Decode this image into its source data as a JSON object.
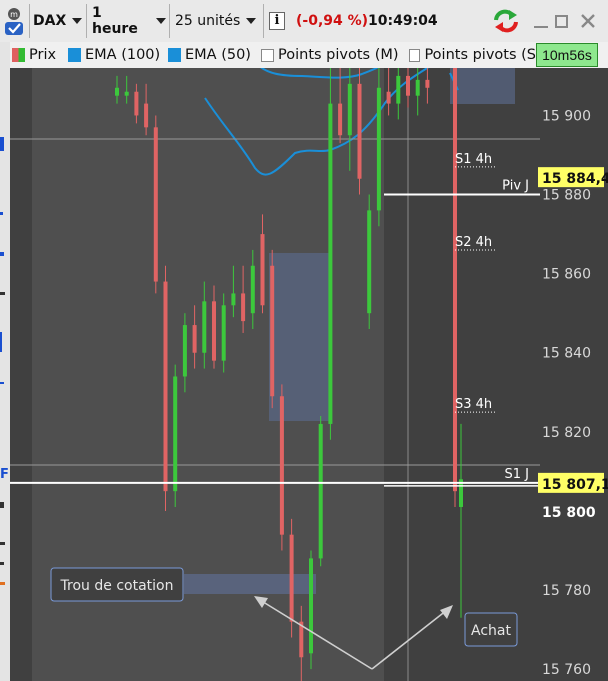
{
  "toolbar": {
    "symbol": "DAX",
    "timeframe": "1 heure",
    "units": "25 unités",
    "info_icon": "info-icon",
    "change_pct": "(-0,94 %)",
    "time": "10:49:04",
    "refresh_icon": "refresh-arrows-icon",
    "window_buttons": [
      "minimize-icon",
      "maximize-icon",
      "close-icon"
    ]
  },
  "legend": {
    "items": [
      {
        "label": "Prix",
        "color": "#e06060",
        "kind": "swatch"
      },
      {
        "label": "EMA (100)",
        "color": "#1a8fd8",
        "kind": "swatch"
      },
      {
        "label": "EMA (50)",
        "color": "#1a8fd8",
        "kind": "swatch"
      },
      {
        "label": "Points pivots (M)",
        "kind": "checkbox"
      },
      {
        "label": "Points pivots (S",
        "kind": "checkbox"
      }
    ],
    "countdown": "10m56s"
  },
  "chart_data": {
    "type": "candlestick",
    "yaxis": {
      "range": [
        15757,
        15912
      ],
      "ticks": [
        "15 760",
        "15 780",
        "15 800",
        "15 820",
        "15 840",
        "15 860",
        "15 880",
        "15 900"
      ],
      "tick_values": [
        15760,
        15780,
        15800,
        15820,
        15840,
        15860,
        15880,
        15900
      ]
    },
    "price_tags": [
      {
        "label": "15 884,4",
        "value": 15884.4,
        "background": "#ffff66"
      },
      {
        "label": "15 807,1",
        "value": 15807.1,
        "background": "#ffff66"
      },
      {
        "label": "15 800",
        "value": 15800,
        "background": "#404040"
      }
    ],
    "candles": [
      {
        "o": 15905,
        "h": 15910,
        "l": 15903,
        "c": 15907
      },
      {
        "o": 15905,
        "h": 15910,
        "l": 15903,
        "c": 15906
      },
      {
        "o": 15906,
        "h": 15908,
        "l": 15898,
        "c": 15900
      },
      {
        "o": 15903,
        "h": 15908,
        "l": 15895,
        "c": 15897
      },
      {
        "o": 15897,
        "h": 15900,
        "l": 15855,
        "c": 15858
      },
      {
        "o": 15858,
        "h": 15862,
        "l": 15800,
        "c": 15805
      },
      {
        "o": 15805,
        "h": 15837,
        "l": 15801,
        "c": 15834
      },
      {
        "o": 15834,
        "h": 15850,
        "l": 15830,
        "c": 15847
      },
      {
        "o": 15847,
        "h": 15852,
        "l": 15836,
        "c": 15840
      },
      {
        "o": 15840,
        "h": 15858,
        "l": 15836,
        "c": 15853
      },
      {
        "o": 15853,
        "h": 15857,
        "l": 15836,
        "c": 15838
      },
      {
        "o": 15838,
        "h": 15855,
        "l": 15835,
        "c": 15852
      },
      {
        "o": 15852,
        "h": 15862,
        "l": 15849,
        "c": 15855
      },
      {
        "o": 15855,
        "h": 15862,
        "l": 15845,
        "c": 15848
      },
      {
        "o": 15850,
        "h": 15866,
        "l": 15846,
        "c": 15862
      },
      {
        "o": 15870,
        "h": 15875,
        "l": 15850,
        "c": 15852
      },
      {
        "o": 15862,
        "h": 15866,
        "l": 15826,
        "c": 15829
      },
      {
        "o": 15829,
        "h": 15832,
        "l": 15790,
        "c": 15794
      },
      {
        "o": 15794,
        "h": 15798,
        "l": 15768,
        "c": 15772
      },
      {
        "o": 15772,
        "h": 15776,
        "l": 15757,
        "c": 15763
      },
      {
        "o": 15764,
        "h": 15790,
        "l": 15760,
        "c": 15788
      },
      {
        "o": 15788,
        "h": 15824,
        "l": 15786,
        "c": 15822
      },
      {
        "o": 15822,
        "h": 15912,
        "l": 15818,
        "c": 15903
      },
      {
        "o": 15903,
        "h": 15912,
        "l": 15893,
        "c": 15895
      },
      {
        "o": 15895,
        "h": 15912,
        "l": 15886,
        "c": 15908
      },
      {
        "o": 15908,
        "h": 15912,
        "l": 15880,
        "c": 15884
      },
      {
        "o": 15850,
        "h": 15880,
        "l": 15846,
        "c": 15876
      },
      {
        "o": 15876,
        "h": 15912,
        "l": 15872,
        "c": 15907
      },
      {
        "o": 15906,
        "h": 15912,
        "l": 15900,
        "c": 15903
      },
      {
        "o": 15903,
        "h": 15912,
        "l": 15899,
        "c": 15910
      },
      {
        "o": 15910,
        "h": 15912,
        "l": 15902,
        "c": 15905
      },
      {
        "o": 15905,
        "h": 15912,
        "l": 15900,
        "c": 15909
      },
      {
        "o": 15909,
        "h": 15912,
        "l": 15903,
        "c": 15907
      },
      {
        "o": 15912,
        "h": 15912,
        "l": 15801,
        "c": 15805
      },
      {
        "o": 15801,
        "h": 15822,
        "l": 15773,
        "c": 15808
      }
    ],
    "pivot_lines": [
      {
        "label": "Piv J",
        "value": 15880
      },
      {
        "label": "S1 J",
        "value": 15807.1
      }
    ],
    "pivot_labels": [
      {
        "label": "S1 4h",
        "value": 15888
      },
      {
        "label": "S2 4h",
        "value": 15867
      },
      {
        "label": "S3 4h",
        "value": 15826
      }
    ],
    "annotations": [
      {
        "label": "Trou de cotation"
      },
      {
        "label": "Achat"
      }
    ]
  }
}
